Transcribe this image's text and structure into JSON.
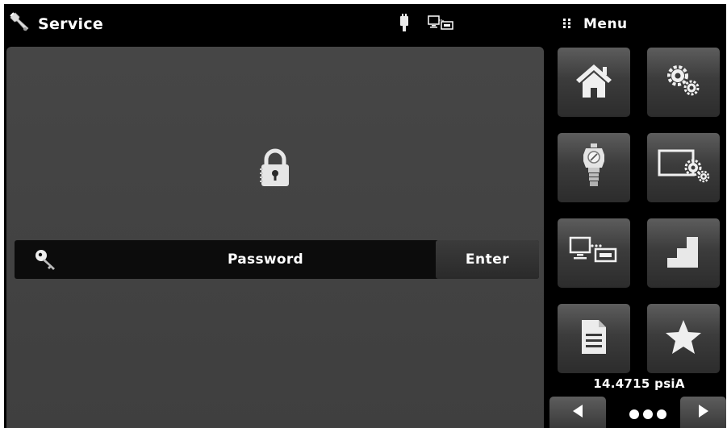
{
  "header": {
    "title": "Service",
    "title_icon": "wrench-icon",
    "status_icons": [
      "usb-icon",
      "network-icon"
    ],
    "menu_icon": "grid-dots-icon",
    "menu_label": "Menu"
  },
  "main": {
    "lock_icon": "lock-icon",
    "password_row": {
      "key_icon": "key-icon",
      "label": "Password",
      "enter_label": "Enter"
    }
  },
  "menu_tiles": [
    {
      "icon": "home-icon"
    },
    {
      "icon": "gears-icon"
    },
    {
      "icon": "sensor-icon"
    },
    {
      "icon": "display-settings-icon"
    },
    {
      "icon": "remote-connection-icon"
    },
    {
      "icon": "step-chart-icon"
    },
    {
      "icon": "document-icon"
    },
    {
      "icon": "star-icon"
    }
  ],
  "status": {
    "pressure_reading": "14.4715 psiA"
  },
  "nav": {
    "prev_icon": "left-arrow-icon",
    "dots_icon": "page-dots-icon",
    "next_icon": "right-arrow-icon"
  },
  "colors": {
    "background": "#000000",
    "panel": "#444444",
    "tile_top": "#5d5d5d",
    "tile_bottom": "#2c2c2c",
    "text": "#ffffff"
  }
}
